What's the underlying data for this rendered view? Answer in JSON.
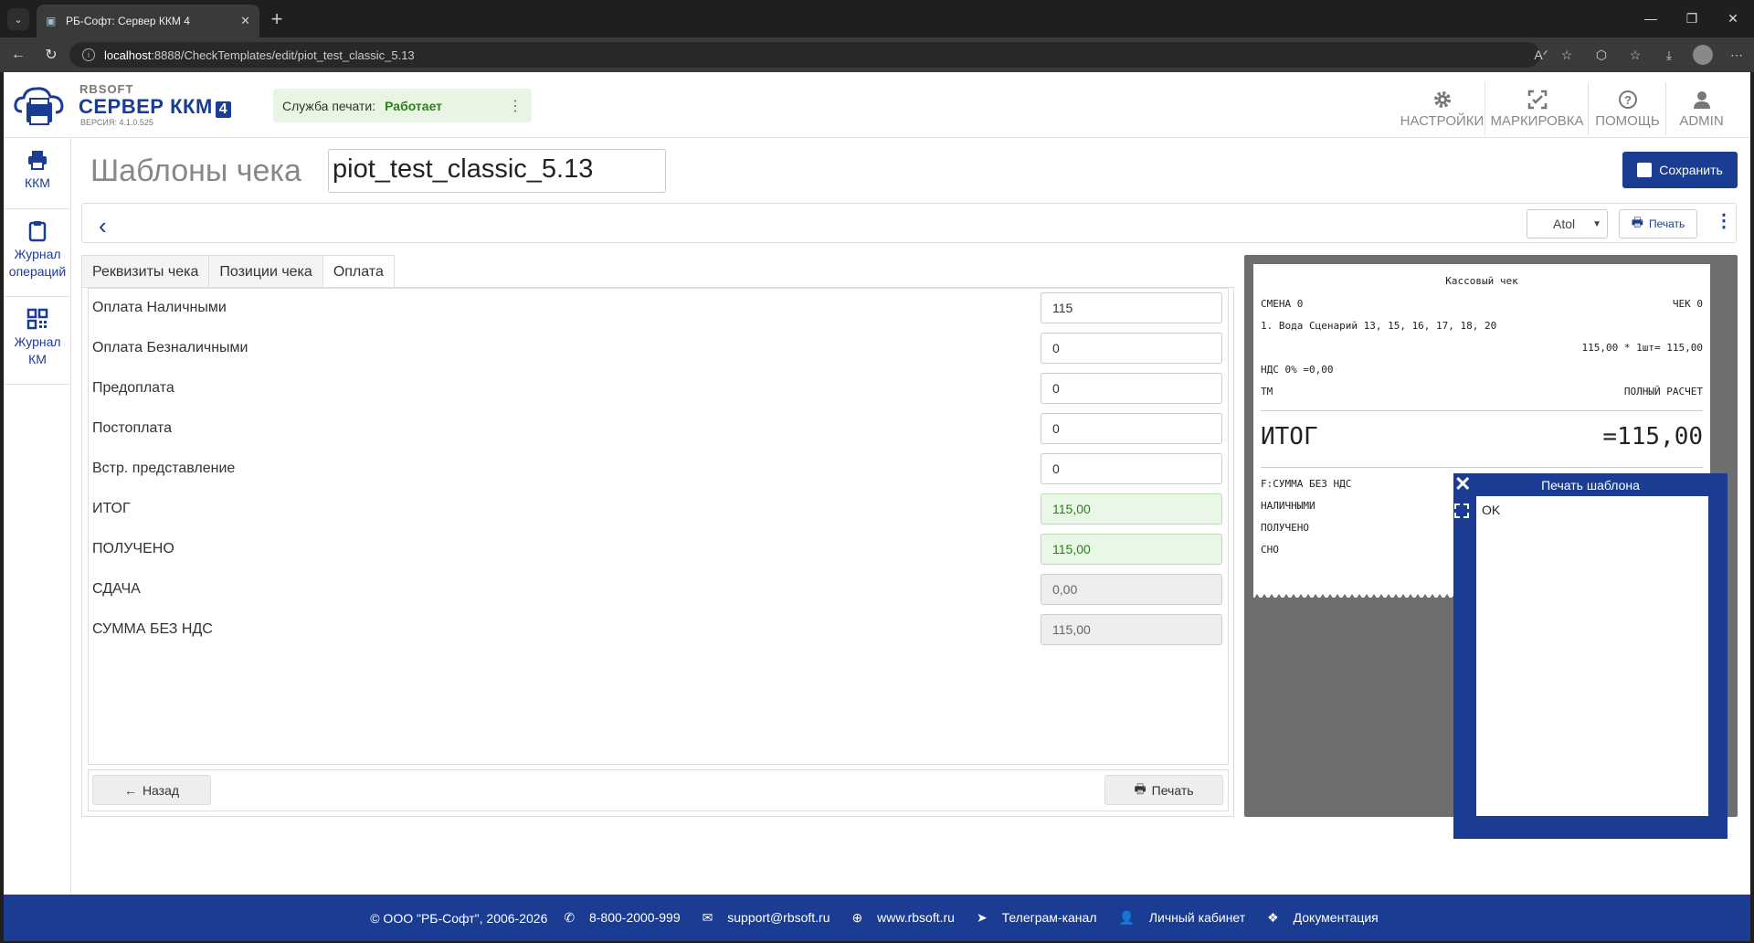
{
  "browser": {
    "tab_title": "РБ-Софт: Сервер ККМ 4",
    "url_host": "localhost",
    "url_rest": ":8888/CheckTemplates/edit/piot_test_classic_5.13"
  },
  "header": {
    "brand_top": "RBSOFT",
    "brand_name": "СЕРВЕР ККМ",
    "brand_four": "4",
    "version": "ВЕРСИЯ: 4.1.0.525",
    "service_label": "Служба печати:",
    "service_status": "Работает",
    "nav": [
      {
        "label": "НАСТРОЙКИ",
        "icon": "gear-icon"
      },
      {
        "label": "МАРКИРОВКА",
        "icon": "scan-icon"
      },
      {
        "label": "ПОМОЩЬ",
        "icon": "help-icon"
      },
      {
        "label": "ADMIN",
        "icon": "user-icon"
      }
    ]
  },
  "sidebar": {
    "items": [
      {
        "label": "ККМ",
        "icon": "printer-icon"
      },
      {
        "label": "Журнал операций",
        "icon": "clipboard-icon"
      },
      {
        "label": "Журнал КМ",
        "icon": "qr-icon"
      }
    ]
  },
  "page": {
    "title": "Шаблоны чека",
    "name": "piot_test_classic_5.13",
    "save_label": "Сохранить",
    "printer_select": "Atol",
    "print_label": "Печать",
    "tabs": [
      "Реквизиты чека",
      "Позиции чека",
      "Оплата"
    ],
    "active_tab": "Оплата",
    "fields": [
      {
        "label": "Оплата Наличными",
        "value": "115",
        "style": "normal"
      },
      {
        "label": "Оплата Безналичными",
        "value": "0",
        "style": "normal"
      },
      {
        "label": "Предоплата",
        "value": "0",
        "style": "normal"
      },
      {
        "label": "Постоплата",
        "value": "0",
        "style": "normal"
      },
      {
        "label": "Встр. представление",
        "value": "0",
        "style": "normal"
      },
      {
        "label": "ИТОГ",
        "value": "115,00",
        "style": "green"
      },
      {
        "label": "ПОЛУЧЕНО",
        "value": "115,00",
        "style": "green"
      },
      {
        "label": "СДАЧА",
        "value": "0,00",
        "style": "gray"
      },
      {
        "label": "СУММА БЕЗ НДС",
        "value": "115,00",
        "style": "gray"
      }
    ],
    "back_label": "Назад",
    "bottom_print_label": "Печать"
  },
  "receipt": {
    "title": "Кассовый чек",
    "shift": "СМЕНА 0",
    "check_no": "ЧЕК 0",
    "item_line": "1. Вода Сценарий 13, 15, 16, 17, 18, 20",
    "item_calc": "115,00 * 1шт= 115,00",
    "vat": "НДС 0% =0,00",
    "tm": "ТМ",
    "calc_type": "ПОЛНЫЙ РАСЧЕТ",
    "total_label": "ИТОГ",
    "total_value": "=115,00",
    "lines": [
      "F:СУММА БЕЗ НДС",
      "НАЛИЧНЫМИ",
      "ПОЛУЧЕНО",
      "СНО"
    ]
  },
  "dialog": {
    "title": "Печать шаблона",
    "body": "OK"
  },
  "footer": {
    "copyright": "© ООО \"РБ-Софт\", 2006-2026",
    "phone": "8-800-2000-999",
    "email": "support@rbsoft.ru",
    "site": "www.rbsoft.ru",
    "telegram": "Телеграм-канал",
    "account": "Личный кабинет",
    "docs": "Документация"
  },
  "colors": {
    "brand": "#1a3c93",
    "ok_green": "#2e7d1e"
  }
}
